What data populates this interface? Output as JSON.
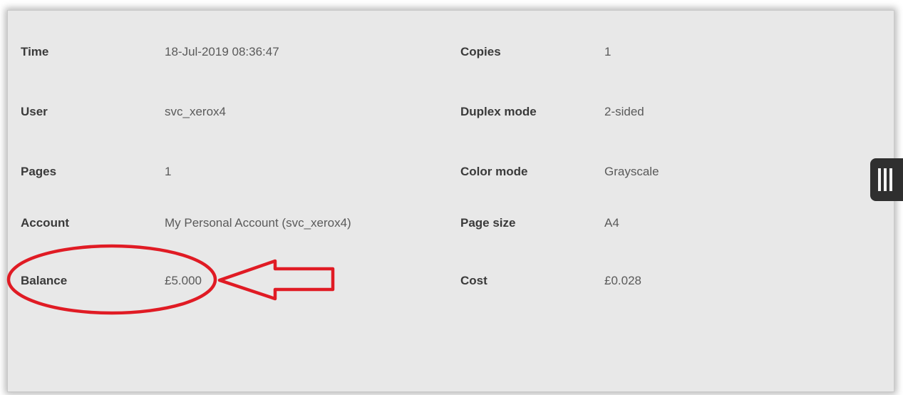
{
  "details": {
    "time_label": "Time",
    "time_value": "18-Jul-2019 08:36:47",
    "copies_label": "Copies",
    "copies_value": "1",
    "user_label": "User",
    "user_value": "svc_xerox4",
    "duplex_label": "Duplex mode",
    "duplex_value": "2-sided",
    "pages_label": "Pages",
    "pages_value": "1",
    "color_label": "Color mode",
    "color_value": "Grayscale",
    "account_label": "Account",
    "account_value": "My Personal Account (svc_xerox4)",
    "page_size_label": "Page size",
    "page_size_value": "A4",
    "balance_label": "Balance",
    "balance_value": "£5.000",
    "cost_label": "Cost",
    "cost_value": "£0.028"
  },
  "side_handle": {
    "icon": "menu-bars-icon"
  },
  "annotation": {
    "color": "#e01b24",
    "shapes": [
      "ellipse",
      "arrow"
    ]
  }
}
